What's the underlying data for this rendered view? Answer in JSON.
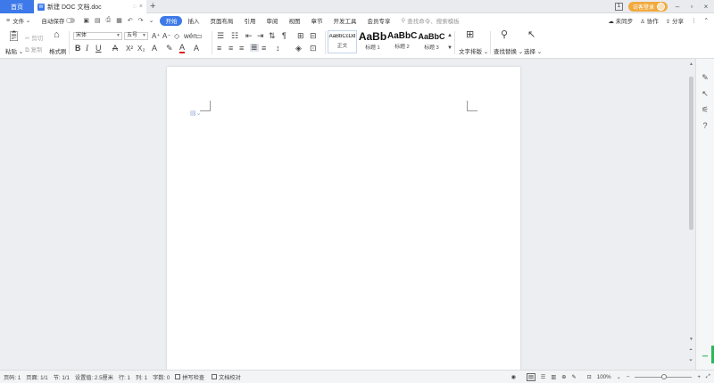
{
  "tabs": {
    "home": "首页",
    "doc_title": "新建 DOC 文档.doc",
    "doc_icon_text": "W",
    "new_tab": "+"
  },
  "titlebar_right": {
    "badge": "1",
    "login": "访客登录"
  },
  "menubar": {
    "file": "文件",
    "autosave": "自动保存",
    "items": [
      "开始",
      "插入",
      "页面布局",
      "引用",
      "审阅",
      "视图",
      "章节",
      "开发工具",
      "会员专享"
    ],
    "search_placeholder": "查找命令、搜索模板",
    "sync": "未同步",
    "collab": "协作",
    "share": "分享"
  },
  "ribbon": {
    "paste": "粘贴",
    "cut": "剪切",
    "copy": "复制",
    "format_painter": "格式刷",
    "font_name": "宋体",
    "font_size": "五号",
    "styles": [
      {
        "sample": "AaBbCcDd",
        "name": "正文"
      },
      {
        "sample": "AaBb",
        "name": "标题 1"
      },
      {
        "sample": "AaBbC",
        "name": "标题 2"
      },
      {
        "sample": "AaBbC",
        "name": "标题 3"
      }
    ],
    "text_layout": "文字排版",
    "find_replace": "查找替换",
    "select": "选择"
  },
  "status": {
    "page_no": "页码: 1",
    "pages": "页面: 1/1",
    "section": "节: 1/1",
    "position": "设置值: 2.5厘米",
    "line": "行: 1",
    "column": "列: 1",
    "word_count": "字数: 0",
    "spell_check": "拼写检查",
    "doc_proof": "文档校对",
    "zoom": "100%"
  },
  "colors": {
    "accent": "#3d79e8",
    "login": "#f1a93d",
    "font_color": "#e02020"
  }
}
